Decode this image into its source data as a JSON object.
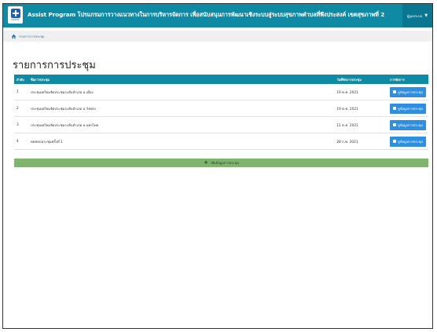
{
  "header": {
    "title": "Assist Program โปรแกรมการวางแนวทางในการบริหารจัดการ เพื่อสนับสนุนการพัฒนาเชิงระบบสู่ระบบสุขภาพตำบลที่พึงประสงค์ เขตสุขภาพที่ 2",
    "logo_text": "ASSIST",
    "user_label": "ผู้ดูแลระบบ"
  },
  "breadcrumb": {
    "current": "รายการการประชุม"
  },
  "page": {
    "title": "รายการการประชุม"
  },
  "table": {
    "headers": [
      "ลำดับ",
      "ชื่อการประชุม",
      "วันที่จัดการประชุม",
      "การจัดการ"
    ],
    "rows": [
      {
        "no": "1",
        "name": "ประชุมเตรียมจัดประชุมระดับอำเภอ อ.เมือง",
        "date": "19 ต.ค. 2021",
        "action": "ดูข้อมูลการประชุม"
      },
      {
        "no": "2",
        "name": "ประชุมเตรียมจัดประชุมระดับอำเภอ อ.วังทอง",
        "date": "19 ต.ค. 2021",
        "action": "ดูข้อมูลการประชุม"
      },
      {
        "no": "3",
        "name": "ประชุมเตรียมจัดประชุมระดับอำเภอ อ.นครไทย",
        "date": "11 ต.ค. 2021",
        "action": "ดูข้อมูลการประชุม"
      },
      {
        "no": "4",
        "name": "ทดสอบประชุมครั้งที่ 1",
        "date": "28 ก.พ. 2021",
        "action": "ดูข้อมูลการประชุม"
      }
    ]
  },
  "actions": {
    "add_label": "เพิ่มข้อมูลการประชุม"
  },
  "colors": {
    "header": "#0e8aa5",
    "button": "#2e8fe0",
    "add": "#7fb36e"
  }
}
